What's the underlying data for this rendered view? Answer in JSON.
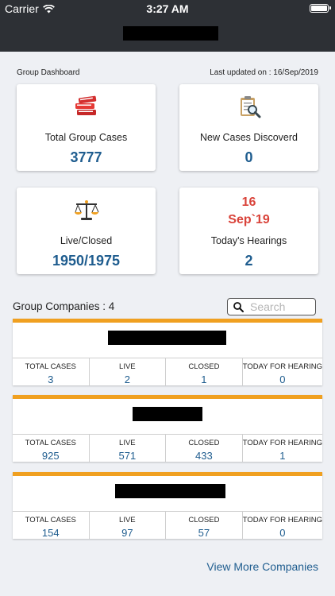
{
  "status_bar": {
    "carrier": "Carrier",
    "time": "3:27 AM"
  },
  "header": {
    "dashboard_label": "Group Dashboard",
    "last_updated": "Last updated on : 16/Sep/2019"
  },
  "cards": {
    "total_cases": {
      "label": "Total Group Cases",
      "value": "3777",
      "icon": "books-icon"
    },
    "new_cases": {
      "label": "New Cases Discoverd",
      "value": "0",
      "icon": "clipboard-search-icon"
    },
    "live_closed": {
      "label": "Live/Closed",
      "value": "1950/1975",
      "icon": "scales-icon"
    },
    "hearings": {
      "day": "16",
      "month": "Sep`19",
      "label": "Today's Hearings",
      "value": "2"
    }
  },
  "companies_section": {
    "label": "Group Companies : 4",
    "search_placeholder": "Search"
  },
  "stat_headers": {
    "total": "TOTAL CASES",
    "live": "LIVE",
    "closed": "CLOSED",
    "today": "TODAY FOR HEARING"
  },
  "companies": [
    {
      "total": "3",
      "live": "2",
      "closed": "1",
      "today": "0"
    },
    {
      "total": "925",
      "live": "571",
      "closed": "433",
      "today": "1"
    },
    {
      "total": "154",
      "live": "97",
      "closed": "57",
      "today": "0"
    }
  ],
  "view_more": "View More Companies",
  "colors": {
    "header_bg": "#2d3035",
    "accent_orange": "#f0a020",
    "value_blue": "#1f5d8f",
    "date_red": "#d9433a"
  }
}
